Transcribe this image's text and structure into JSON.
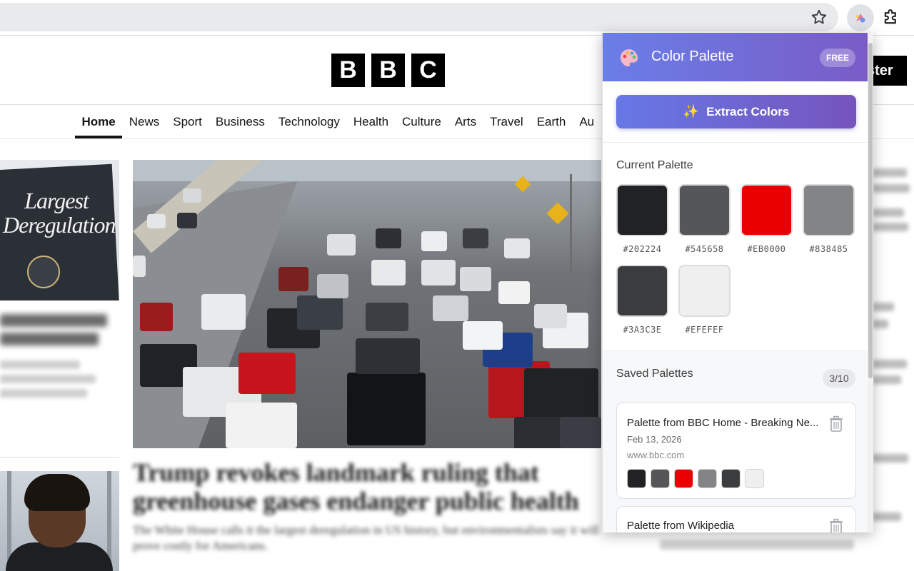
{
  "browser": {
    "star_icon": "star-icon",
    "extension_icon": "palette-extension-icon",
    "puzzle_icon": "puzzle-icon"
  },
  "bbc": {
    "logo_letters": [
      "B",
      "B",
      "C"
    ],
    "register_label": "ster",
    "nav": [
      "Home",
      "News",
      "Sport",
      "Business",
      "Technology",
      "Health",
      "Culture",
      "Arts",
      "Travel",
      "Earth",
      "Au"
    ],
    "sign_text": "Largest Deregulation",
    "hero_headline": "Trump revokes landmark ruling that greenhouse gases endanger public health",
    "hero_subtext": "The White House calls it the largest deregulation in US history, but environmentalists say it will prove costly for Americans."
  },
  "popup": {
    "title": "Color Palette",
    "badge": "FREE",
    "extract_label": "Extract Colors",
    "current_title": "Current Palette",
    "swatches": [
      {
        "hex": "#202224",
        "label": "#202224"
      },
      {
        "hex": "#545658",
        "label": "#545658"
      },
      {
        "hex": "#EB0000",
        "label": "#EB0000"
      },
      {
        "hex": "#838485",
        "label": "#838485"
      },
      {
        "hex": "#3A3C3E",
        "label": "#3A3C3E"
      },
      {
        "hex": "#EFEFEF",
        "label": "#EFEFEF"
      }
    ],
    "saved_title": "Saved Palettes",
    "saved_count": "3/10",
    "saved": [
      {
        "title": "Palette from BBC Home - Breaking Ne...",
        "date": "Feb 13, 2026",
        "domain": "www.bbc.com",
        "colors": [
          "#202224",
          "#545658",
          "#EB0000",
          "#838485",
          "#3A3C3E",
          "#EFEFEF"
        ]
      },
      {
        "title": "Palette from Wikipedia"
      }
    ]
  }
}
